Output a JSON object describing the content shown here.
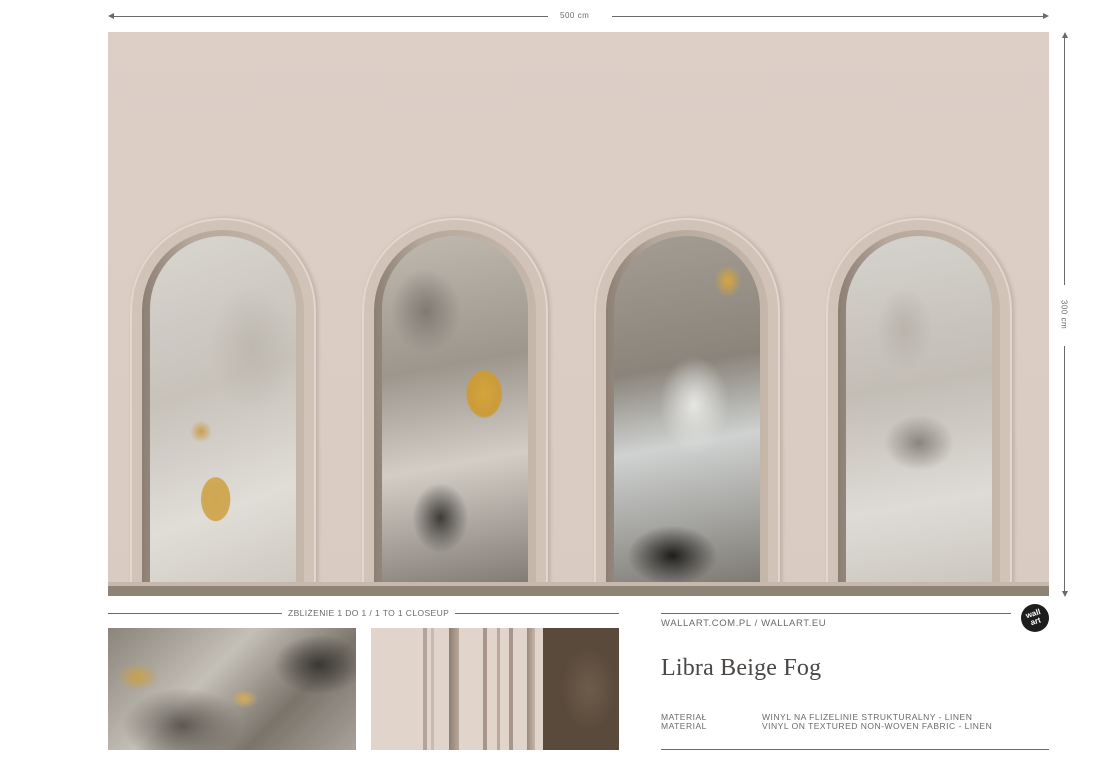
{
  "dimensions": {
    "width_label": "500 cm",
    "height_label": "300 cm"
  },
  "closeup": {
    "label": "ZBLIŻENIE 1 DO 1 / 1 TO 1 CLOSEUP"
  },
  "brand": {
    "urls": "WALLART.COM.PL / WALLART.EU",
    "logo_line1": "wall",
    "logo_line2": "art"
  },
  "product": {
    "title": "Libra Beige Fog"
  },
  "specs": [
    {
      "label": "MATERIAŁ",
      "value": "WINYL NA FLIZELINIE STRUKTURALNY - LINEN"
    },
    {
      "label": "MATERIAL",
      "value": "VINYL ON TEXTURED NON-WOVEN FABRIC - LINEN"
    }
  ],
  "colors": {
    "wall": "#ddcfc6",
    "floor": "#8f8375",
    "gold_accent": "#d4a53c",
    "text": "#6d6a66",
    "logo_bg": "#1d1d1d"
  }
}
